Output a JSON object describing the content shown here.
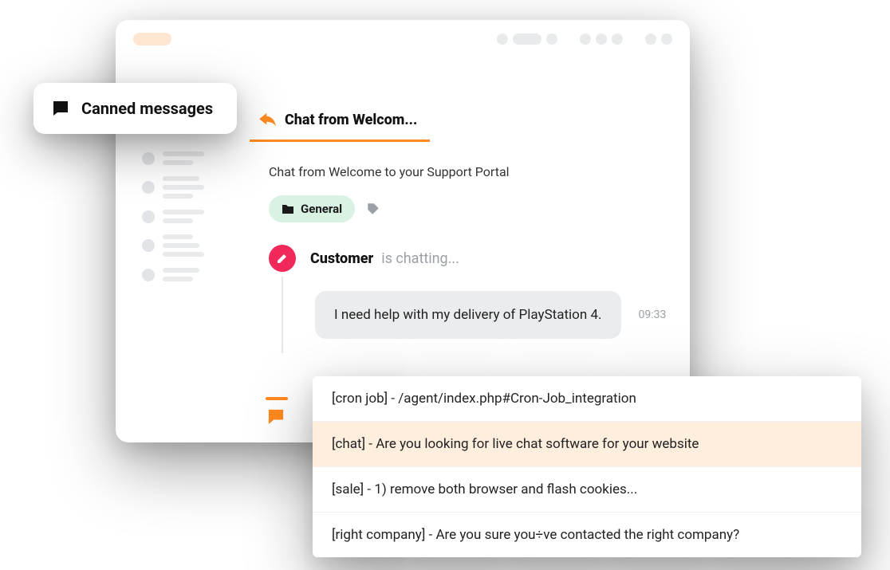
{
  "canned_label": "Canned messages",
  "tab": {
    "label": "Chat from Welcom..."
  },
  "chat": {
    "title": "Chat from Welcome to your Support Portal",
    "folder": "General",
    "sender_name": "Customer",
    "sender_status": "is chatting...",
    "message_text": "I need help with my delivery of PlayStation 4.",
    "message_time": "09:33"
  },
  "suggestions": [
    {
      "text": "[cron job] - /agent/index.php#Cron-Job_integration",
      "active": false
    },
    {
      "text": "[chat] - Are you looking for live chat software for your website",
      "active": true
    },
    {
      "text": "[sale] - 1) remove both browser and flash cookies...",
      "active": false
    },
    {
      "text": "[right company] - Are you sure you÷ve contacted the right company?",
      "active": false
    }
  ],
  "colors": {
    "accent": "#ff8a1f",
    "badge": "#f0295a",
    "chip_bg": "#d9f2e3",
    "suggest_active": "#fdeedd"
  }
}
